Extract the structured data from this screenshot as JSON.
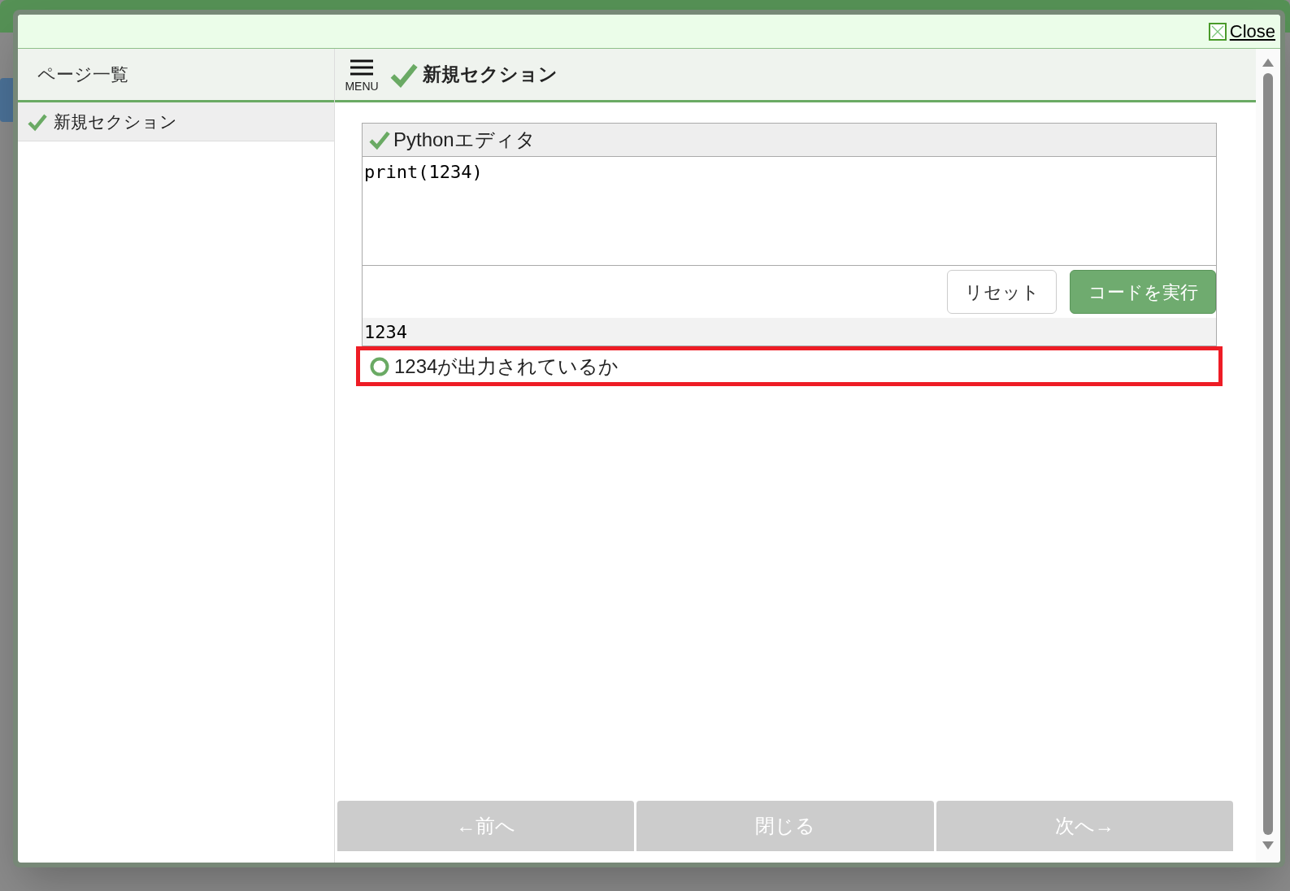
{
  "dialog": {
    "close_label": "Close"
  },
  "sidebar": {
    "title": "ページ一覧",
    "items": [
      {
        "label": "新規セクション",
        "completed": true,
        "selected": true
      }
    ]
  },
  "main": {
    "menu_label": "MENU",
    "title": "新規セクション",
    "title_completed": true
  },
  "editor": {
    "title": "Pythonエディタ",
    "completed": true,
    "code": "print(1234)",
    "buttons": [
      {
        "label": "リセット",
        "kind": "secondary"
      },
      {
        "label": "コードを実行",
        "kind": "primary"
      }
    ],
    "output": "1234"
  },
  "checks": [
    {
      "label": "1234が出力されているか",
      "highlighted": true
    }
  ],
  "nav_buttons": [
    {
      "label": "←前へ",
      "disabled": true
    },
    {
      "label": "閉じる",
      "disabled": true
    },
    {
      "label": "次へ→",
      "disabled": true
    }
  ]
}
